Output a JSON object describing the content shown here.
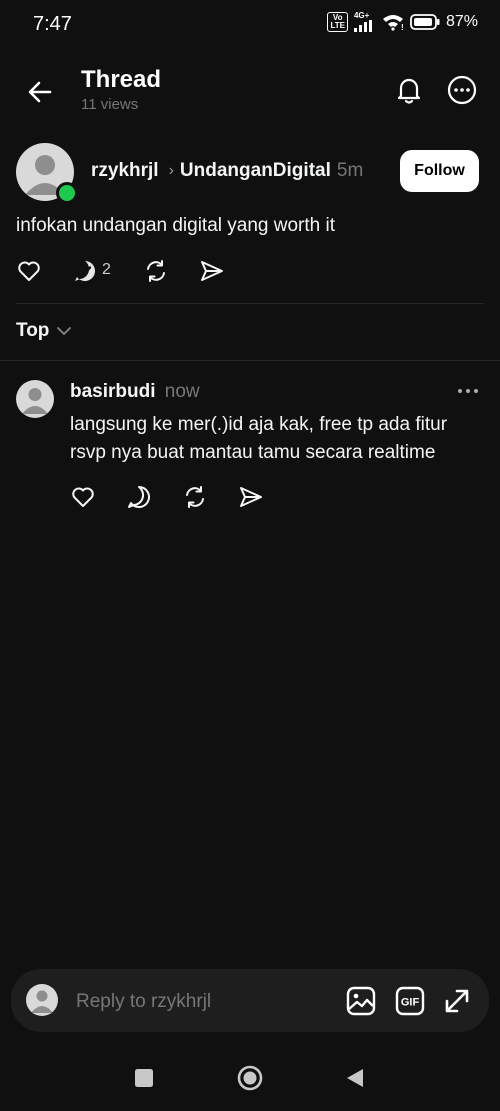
{
  "status": {
    "time": "7:47",
    "volte": "Vo LTE",
    "network": "4G+",
    "battery": "87%"
  },
  "header": {
    "title": "Thread",
    "views": "11 views"
  },
  "post": {
    "username": "rzykhrjl",
    "community": "UndanganDigital",
    "time": "5m",
    "follow_label": "Follow",
    "text": "infokan undangan digital yang worth it",
    "reply_count": "2"
  },
  "sort": {
    "label": "Top"
  },
  "reply": {
    "username": "basirbudi",
    "time": "now",
    "text": "langsung ke mer(.)id aja kak, free tp ada fitur rsvp nya buat mantau tamu secara realtime"
  },
  "composer": {
    "placeholder": "Reply to rzykhrjl",
    "gif_label": "GIF"
  },
  "colors": {
    "background": "#101010",
    "online": "#1ec94d",
    "secondary_text": "#777777"
  },
  "icons": [
    "back-arrow-icon",
    "bell-icon",
    "more-circle-icon",
    "heart-icon",
    "reply-check-icon",
    "repost-icon",
    "share-icon",
    "chevron-down-icon",
    "image-icon",
    "gif-icon",
    "expand-icon"
  ]
}
